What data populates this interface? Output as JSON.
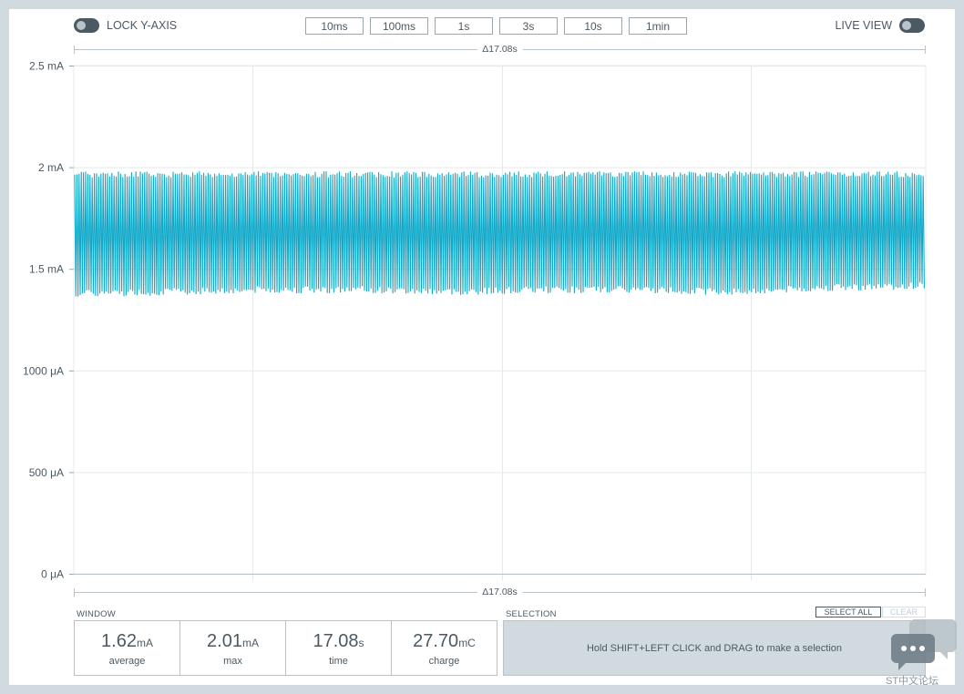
{
  "header": {
    "lock_yaxis_label": "LOCK Y-AXIS",
    "live_view_label": "LIVE VIEW",
    "lock_yaxis_on": false,
    "live_view_on": false,
    "time_buttons": [
      "10ms",
      "100ms",
      "1s",
      "3s",
      "10s",
      "1min"
    ]
  },
  "chart": {
    "delta_top": "Δ17.08s",
    "delta_bottom": "Δ17.08s",
    "series_color": "#12a9c9"
  },
  "chart_data": {
    "type": "line",
    "title": "",
    "xlabel": "",
    "ylabel": "",
    "yticks": [
      "0 μA",
      "500 μA",
      "1000 μA",
      "1.5 mA",
      "2 mA",
      "2.5 mA"
    ],
    "ylim_mA": [
      0,
      2.5
    ],
    "x_span_s": 17.08,
    "series": [
      {
        "values_mA_envelope": {
          "min": [
            1.36,
            1.37,
            1.38,
            1.38,
            1.37,
            1.38,
            1.38,
            1.37,
            1.39,
            1.4
          ],
          "max": [
            1.98,
            1.98,
            1.98,
            1.98,
            1.98,
            1.98,
            1.98,
            1.98,
            1.98,
            1.98
          ]
        }
      }
    ],
    "grid": true
  },
  "window": {
    "label": "WINDOW",
    "stats": [
      {
        "value": "1.62",
        "unit": "mA",
        "name": "average"
      },
      {
        "value": "2.01",
        "unit": "mA",
        "name": "max"
      },
      {
        "value": "17.08",
        "unit": "s",
        "name": "time"
      },
      {
        "value": "27.70",
        "unit": "mC",
        "name": "charge"
      }
    ]
  },
  "selection": {
    "label": "SELECTION",
    "select_all": "SELECT ALL",
    "clear": "CLEAR",
    "hint": "Hold SHIFT+LEFT CLICK and DRAG to make a selection"
  },
  "watermark": {
    "text": "ST中文论坛"
  }
}
